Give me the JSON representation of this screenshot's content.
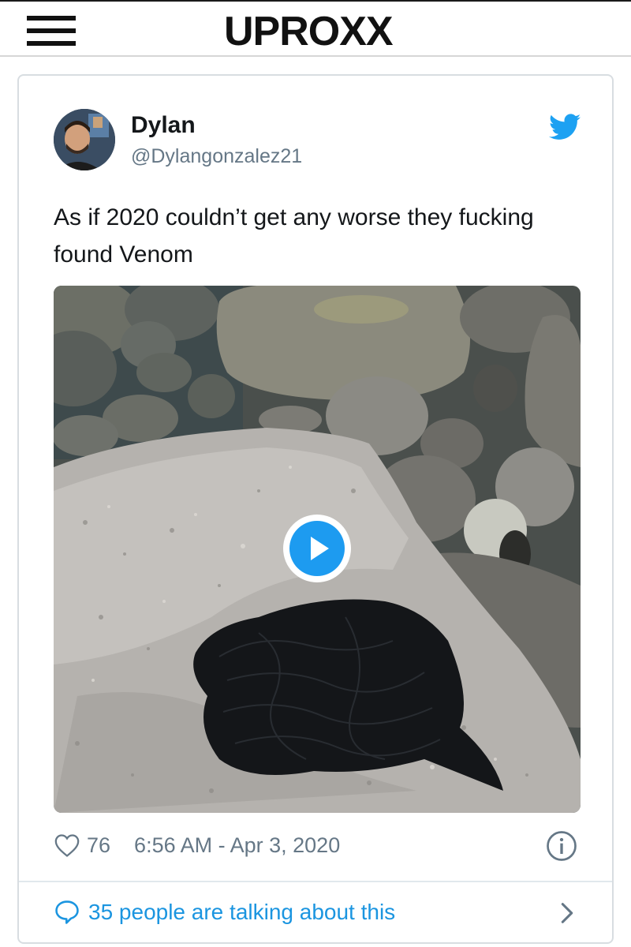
{
  "header": {
    "logo_text": "UPROXX"
  },
  "tweet": {
    "author_name": "Dylan",
    "author_handle": "@Dylangonzalez21",
    "text": "As if 2020 couldn’t get any worse they fucking found Venom",
    "likes": "76",
    "timestamp": "6:56 AM - Apr 3, 2020",
    "conversation_text": "35 people are talking about this",
    "media_type": "video"
  },
  "icons": {
    "menu": "hamburger-menu-icon",
    "twitter": "twitter-bird-icon",
    "like": "heart-outline-icon",
    "info": "info-circle-icon",
    "reply": "speech-bubble-icon",
    "more": "chevron-right-icon",
    "play": "play-icon"
  },
  "colors": {
    "twitter_blue": "#1da1f2",
    "link_blue": "#1b95e0",
    "muted_gray": "#657786"
  }
}
